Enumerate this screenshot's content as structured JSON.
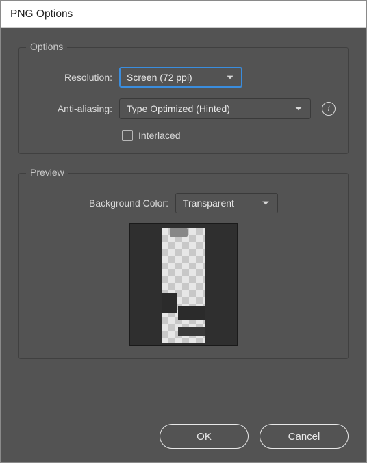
{
  "title": "PNG Options",
  "options": {
    "legend": "Options",
    "resolution_label": "Resolution:",
    "resolution_value": "Screen (72 ppi)",
    "antialias_label": "Anti-aliasing:",
    "antialias_value": "Type Optimized (Hinted)",
    "interlaced_label": "Interlaced",
    "interlaced_checked": false
  },
  "preview": {
    "legend": "Preview",
    "bgcolor_label": "Background Color:",
    "bgcolor_value": "Transparent"
  },
  "buttons": {
    "ok": "OK",
    "cancel": "Cancel"
  }
}
